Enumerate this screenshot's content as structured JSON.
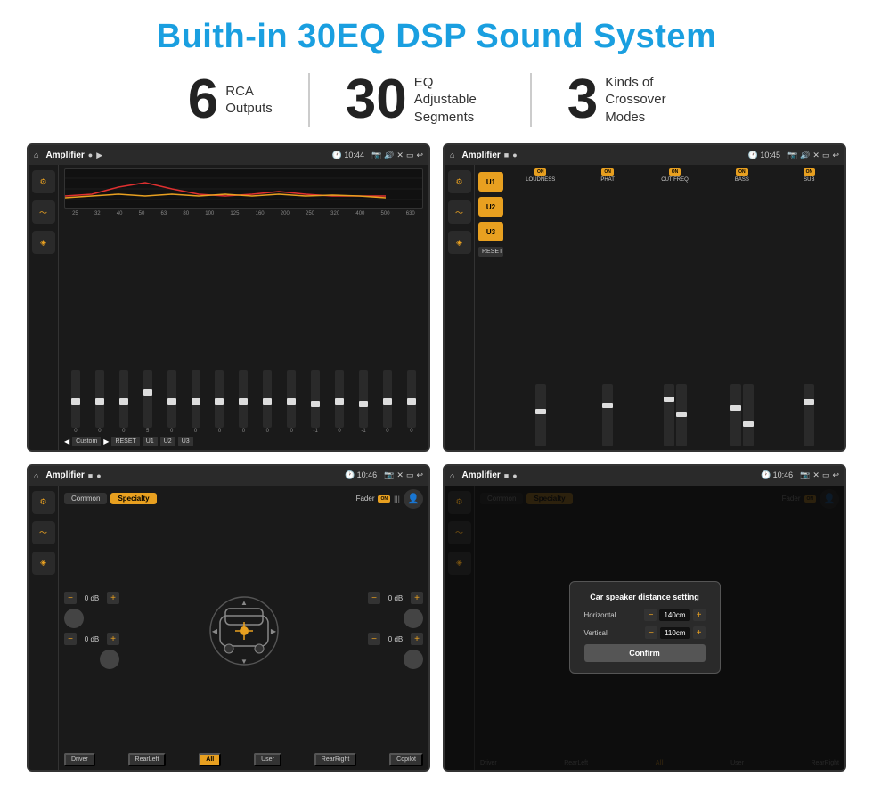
{
  "title": "Buith-in 30EQ DSP Sound System",
  "stats": [
    {
      "number": "6",
      "text": "RCA\nOutputs"
    },
    {
      "number": "30",
      "text": "EQ Adjustable\nSegments"
    },
    {
      "number": "3",
      "text": "Kinds of\nCrossover Modes"
    }
  ],
  "screens": [
    {
      "id": "eq-screen",
      "statusBar": {
        "title": "Amplifier",
        "time": "10:44"
      },
      "type": "equalizer"
    },
    {
      "id": "crossover-screen",
      "statusBar": {
        "title": "Amplifier",
        "time": "10:45"
      },
      "type": "crossover"
    },
    {
      "id": "fader-screen",
      "statusBar": {
        "title": "Amplifier",
        "time": "10:46"
      },
      "type": "fader"
    },
    {
      "id": "dialog-screen",
      "statusBar": {
        "title": "Amplifier",
        "time": "10:46"
      },
      "type": "dialog",
      "dialog": {
        "title": "Car speaker distance setting",
        "horizontal": {
          "label": "Horizontal",
          "value": "140cm"
        },
        "vertical": {
          "label": "Vertical",
          "value": "110cm"
        },
        "confirmBtn": "Confirm"
      }
    }
  ],
  "eq": {
    "bands": [
      "25",
      "32",
      "40",
      "50",
      "63",
      "80",
      "100",
      "125",
      "160",
      "200",
      "250",
      "320",
      "400",
      "500",
      "630"
    ],
    "values": [
      "0",
      "0",
      "0",
      "5",
      "0",
      "0",
      "0",
      "0",
      "0",
      "0",
      "-1",
      "0",
      "-1"
    ],
    "presets": [
      "Custom",
      "RESET",
      "U1",
      "U2",
      "U3"
    ]
  },
  "crossover": {
    "presets": [
      "U1",
      "U2",
      "U3"
    ],
    "channels": [
      "LOUDNESS",
      "PHAT",
      "CUT FREQ",
      "BASS",
      "SUB"
    ],
    "resetBtn": "RESET"
  },
  "fader": {
    "tabs": [
      "Common",
      "Specialty"
    ],
    "faderLabel": "Fader",
    "onLabel": "ON",
    "channels": [
      {
        "label": "0 dB"
      },
      {
        "label": "0 dB"
      },
      {
        "label": "0 dB"
      },
      {
        "label": "0 dB"
      }
    ],
    "bottomBtns": [
      "Driver",
      "RearLeft",
      "All",
      "User",
      "RearRight",
      "Copilot"
    ]
  },
  "dialog": {
    "title": "Car speaker distance setting",
    "horizontal": "140cm",
    "vertical": "110cm",
    "confirmBtn": "Confirm"
  }
}
